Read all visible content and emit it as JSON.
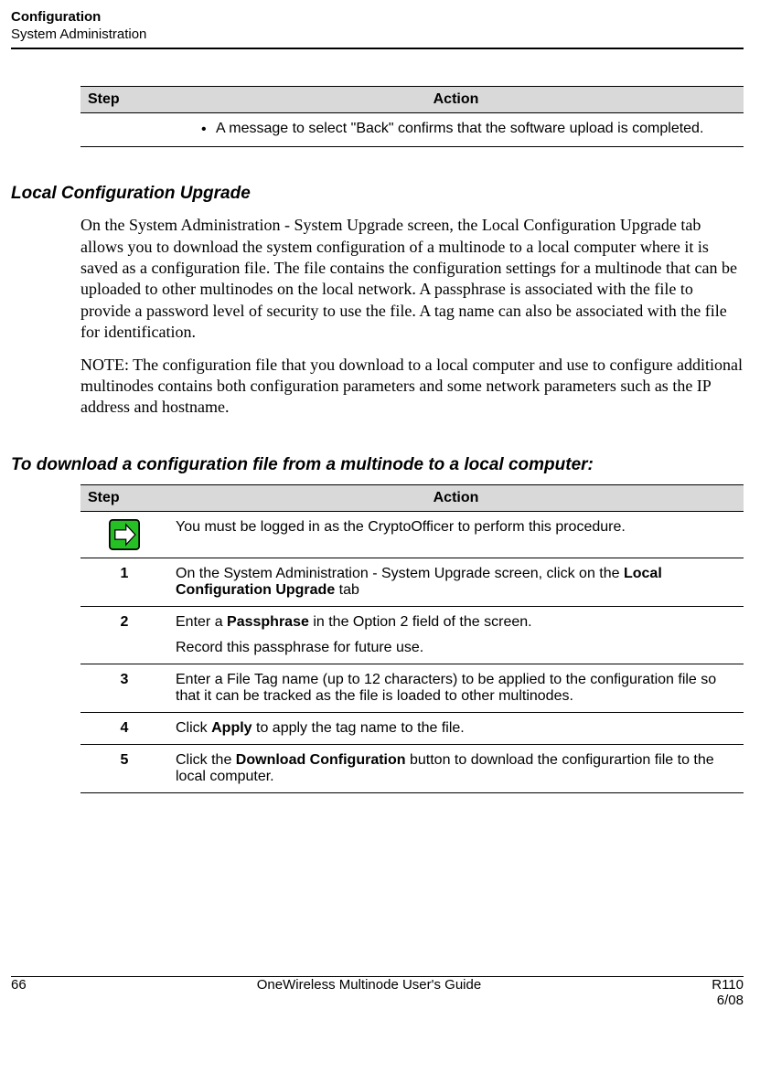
{
  "header": {
    "title": "Configuration",
    "subtitle": "System Administration"
  },
  "table1": {
    "headers": {
      "step": "Step",
      "action": "Action"
    },
    "row_bullet": "A message to select \"Back\" confirms that the software upload is completed."
  },
  "section1": {
    "title": "Local Configuration Upgrade",
    "para1": "On the System Administration - System Upgrade screen, the Local Configuration Upgrade tab allows you to download the system configuration of a multinode to a local computer where it is saved as a configuration file.  The file contains the configuration settings for a multinode that can be uploaded to other multinodes on the local network.  A passphrase is associated with the file to provide a password level of security to use the file.  A tag name can also be associated with the file for identification.",
    "para2": "NOTE:  The configuration file that you download to a local computer and use to configure additional multinodes contains both configuration parameters and some network parameters such as the IP address and hostname."
  },
  "section2": {
    "title": "To download a configuration file from a multinode to a local computer:",
    "headers": {
      "step": "Step",
      "action": "Action"
    },
    "rows": {
      "note": "You must be logged in as the CryptoOfficer to perform this procedure.",
      "r1_num": "1",
      "r1_pre": "On the System Administration - System Upgrade screen, click on the ",
      "r1_bold": "Local Configuration Upgrade",
      "r1_post": " tab",
      "r2_num": "2",
      "r2_a_pre": "Enter a ",
      "r2_a_bold": "Passphrase",
      "r2_a_post": " in the Option 2 field of the screen.",
      "r2_b": "Record this passphrase for future use.",
      "r3_num": "3",
      "r3": "Enter a File Tag name (up to 12 characters) to be applied to the configuration file so that it can be tracked as the file is loaded to other multinodes.",
      "r4_num": "4",
      "r4_pre": "Click ",
      "r4_bold": "Apply",
      "r4_post": " to apply the tag name to the file.",
      "r5_num": "5",
      "r5_pre": "Click the ",
      "r5_bold": "Download Configuration",
      "r5_post": " button to download the configurartion file to the local computer."
    }
  },
  "footer": {
    "page": "66",
    "center": "OneWireless Multinode User's Guide",
    "right1": "R110",
    "right2": "6/08"
  }
}
